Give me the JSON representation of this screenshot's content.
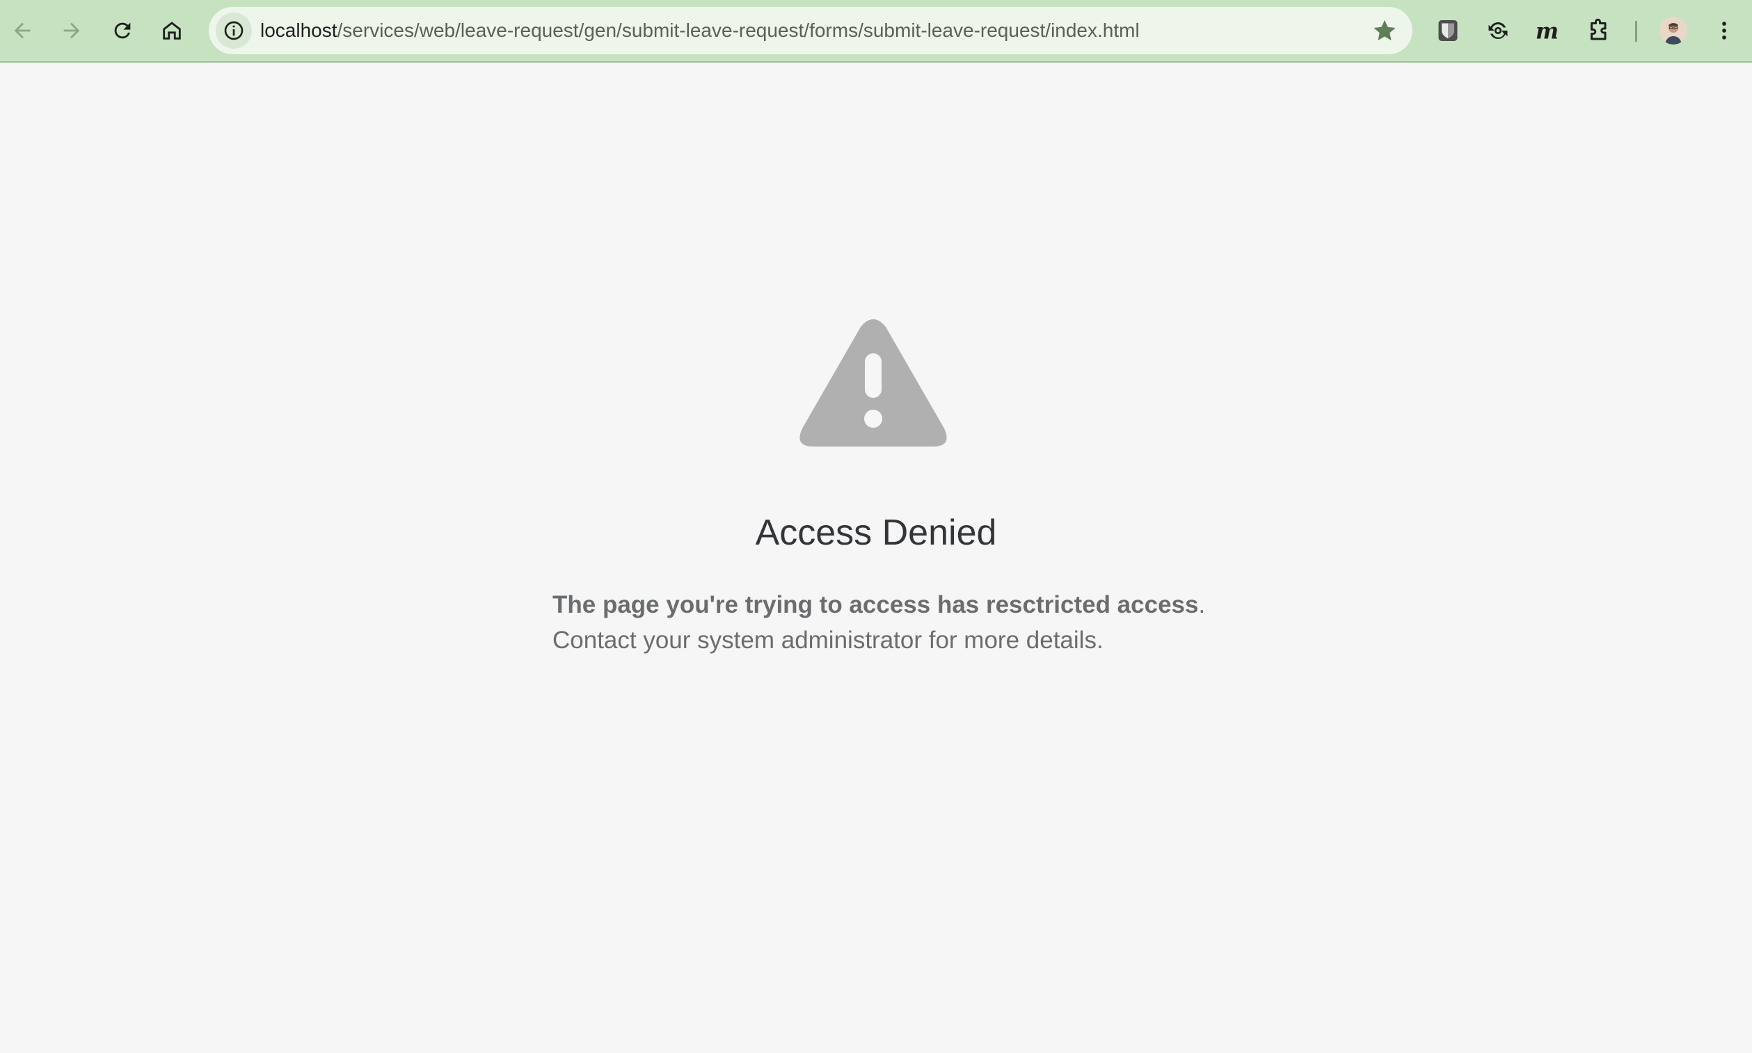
{
  "browser": {
    "url_host": "localhost",
    "url_path": "/services/web/leave-request/gen/submit-leave-request/forms/submit-leave-request/index.html",
    "icons": {
      "back": "arrow-left-icon",
      "forward": "arrow-right-icon",
      "reload": "reload-icon",
      "home": "home-icon",
      "site_info": "info-icon",
      "bookmark": "star-icon",
      "extension_1": "bitwarden-shield-icon",
      "extension_2": "sync-icon",
      "extension_3": "m-letter-icon",
      "extensions": "puzzle-icon",
      "menu": "vertical-dots-icon"
    },
    "colors": {
      "toolbar_bg": "#c6e2c0",
      "omnibox_bg": "#eef6ec"
    }
  },
  "page": {
    "icon": "warning-triangle-icon",
    "title": "Access Denied",
    "message_strong": "The page you're trying to access has resctricted access",
    "message_period": ".",
    "message_line2": "Contact your system administrator for more details.",
    "colors": {
      "background": "#f6f6f6",
      "icon": "#b0b0b0",
      "title": "#32363a",
      "text": "#6a6d70"
    }
  }
}
